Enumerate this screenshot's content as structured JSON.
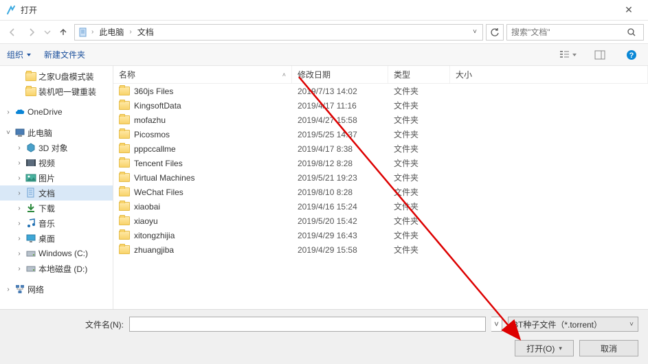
{
  "window": {
    "title": "打开"
  },
  "breadcrumb": {
    "items": [
      "此电脑",
      "文档"
    ],
    "refresh_tooltip": "刷新",
    "dropdown_tooltip": "最近位置"
  },
  "search": {
    "placeholder": "搜索\"文档\""
  },
  "toolbar": {
    "organize": "组织",
    "new_folder": "新建文件夹"
  },
  "sidebar": {
    "items": [
      {
        "label": "之家U盘模式装",
        "icon": "folder",
        "caret": "none",
        "indent": 1
      },
      {
        "label": "装机吧一键重装",
        "icon": "folder",
        "caret": "none",
        "indent": 1
      },
      {
        "label": "",
        "spacer": true
      },
      {
        "label": "OneDrive",
        "icon": "onedrive",
        "caret": "right",
        "indent": 0
      },
      {
        "label": "",
        "spacer": true
      },
      {
        "label": "此电脑",
        "icon": "pc",
        "caret": "down",
        "indent": 0
      },
      {
        "label": "3D 对象",
        "icon": "3d",
        "caret": "right",
        "indent": 1
      },
      {
        "label": "视频",
        "icon": "video",
        "caret": "right",
        "indent": 1,
        "selected": true
      },
      {
        "label": "图片",
        "icon": "picture",
        "caret": "right",
        "indent": 1
      },
      {
        "label": "文档",
        "icon": "document",
        "caret": "right",
        "indent": 1,
        "highlighted": true
      },
      {
        "label": "下载",
        "icon": "download",
        "caret": "right",
        "indent": 1
      },
      {
        "label": "音乐",
        "icon": "music",
        "caret": "right",
        "indent": 1
      },
      {
        "label": "桌面",
        "icon": "desktop",
        "caret": "right",
        "indent": 1
      },
      {
        "label": "Windows (C:)",
        "icon": "disk",
        "caret": "right",
        "indent": 1
      },
      {
        "label": "本地磁盘 (D:)",
        "icon": "disk",
        "caret": "right",
        "indent": 1
      },
      {
        "label": "",
        "spacer": true
      },
      {
        "label": "网络",
        "icon": "network",
        "caret": "right",
        "indent": 0
      }
    ]
  },
  "columns": {
    "name": "名称",
    "date": "修改日期",
    "type": "类型",
    "size": "大小",
    "sort": "asc"
  },
  "files": [
    {
      "name": "360js Files",
      "date": "2019/7/13 14:02",
      "type": "文件夹"
    },
    {
      "name": "KingsoftData",
      "date": "2019/4/17 11:16",
      "type": "文件夹"
    },
    {
      "name": "mofazhu",
      "date": "2019/4/27 15:58",
      "type": "文件夹"
    },
    {
      "name": "Picosmos",
      "date": "2019/5/25 14:37",
      "type": "文件夹"
    },
    {
      "name": "pppccallme",
      "date": "2019/4/17 8:38",
      "type": "文件夹"
    },
    {
      "name": "Tencent Files",
      "date": "2019/8/12 8:28",
      "type": "文件夹"
    },
    {
      "name": "Virtual Machines",
      "date": "2019/5/21 19:23",
      "type": "文件夹"
    },
    {
      "name": "WeChat Files",
      "date": "2019/8/10 8:28",
      "type": "文件夹"
    },
    {
      "name": "xiaobai",
      "date": "2019/4/16 15:24",
      "type": "文件夹"
    },
    {
      "name": "xiaoyu",
      "date": "2019/5/20 15:42",
      "type": "文件夹"
    },
    {
      "name": "xitongzhijia",
      "date": "2019/4/29 16:43",
      "type": "文件夹"
    },
    {
      "name": "zhuangjiba",
      "date": "2019/4/29 15:58",
      "type": "文件夹"
    }
  ],
  "footer": {
    "filename_label": "文件名(N):",
    "filename_value": "",
    "filetype": "BT种子文件（*.torrent）",
    "open": "打开(O)",
    "cancel": "取消"
  }
}
